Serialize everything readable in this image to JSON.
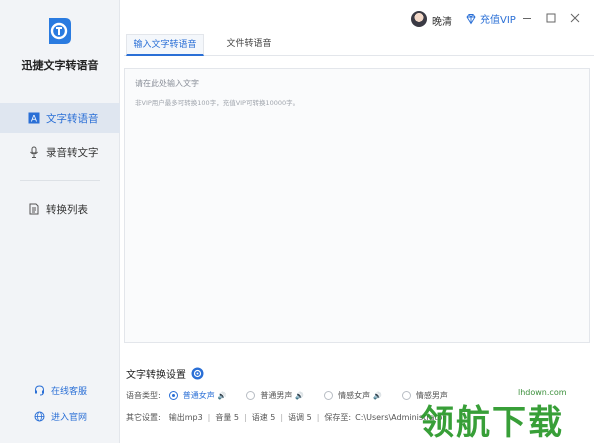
{
  "app": {
    "name": "迅捷文字转语音"
  },
  "sidebar": {
    "items": [
      {
        "label": "文字转语音",
        "icon": "text-a-icon",
        "active": true
      },
      {
        "label": "录音转文字",
        "icon": "microphone-icon",
        "active": false
      },
      {
        "label": "转换列表",
        "icon": "document-list-icon",
        "active": false
      }
    ],
    "footer": [
      {
        "label": "在线客服",
        "icon": "headset-icon"
      },
      {
        "label": "进入官网",
        "icon": "globe-icon"
      }
    ]
  },
  "topbar": {
    "username": "晚清",
    "vip_label": "充值VIP"
  },
  "tabs": [
    {
      "label": "输入文字转语音",
      "active": true
    },
    {
      "label": "文件转语音",
      "active": false
    }
  ],
  "editor": {
    "placeholder": "请在此处输入文字",
    "hint": "非VIP用户最多可转换100字，充值VIP可转换10000字。"
  },
  "settings": {
    "title": "文字转换设置",
    "voice_label": "语音类型:",
    "voices": [
      {
        "label": "普通女声",
        "selected": true
      },
      {
        "label": "普通男声",
        "selected": false
      },
      {
        "label": "情感女声",
        "selected": false
      },
      {
        "label": "情感男声",
        "selected": false
      }
    ],
    "other_label": "其它设置:",
    "format": "输出mp3",
    "volume": "音量 5",
    "speed": "语速 5",
    "pitch": "语调 5",
    "save_label": "保存至:",
    "save_path": "C:\\Users\\Administrator"
  },
  "watermark": {
    "url": "lhdown.com",
    "text": "领航下载"
  },
  "colors": {
    "accent": "#2a6fd6",
    "sidebar_bg": "#f2f4f7",
    "watermark": "#2e9a2e"
  }
}
